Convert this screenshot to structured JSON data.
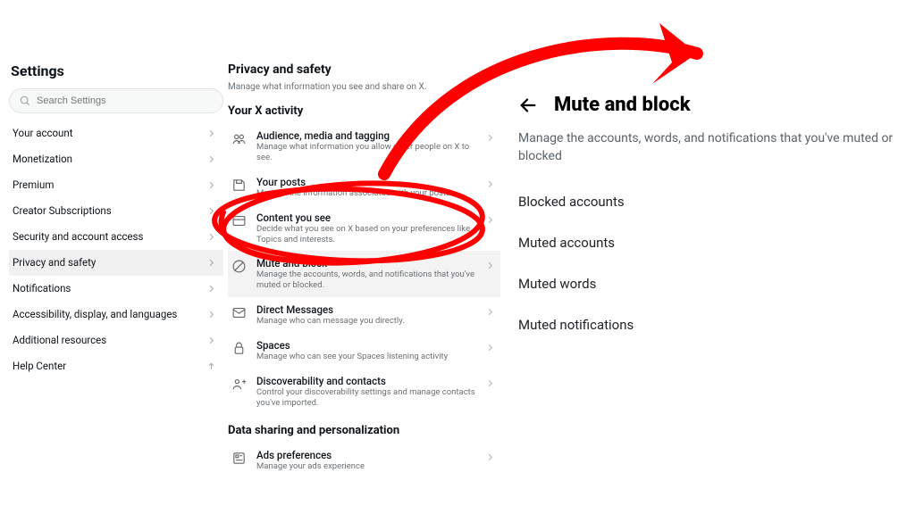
{
  "left": {
    "title": "Settings",
    "search_placeholder": "Search Settings",
    "items": [
      {
        "label": "Your account"
      },
      {
        "label": "Monetization"
      },
      {
        "label": "Premium"
      },
      {
        "label": "Creator Subscriptions"
      },
      {
        "label": "Security and account access"
      },
      {
        "label": "Privacy and safety",
        "active": true
      },
      {
        "label": "Notifications"
      },
      {
        "label": "Accessibility, display, and languages"
      },
      {
        "label": "Additional resources"
      },
      {
        "label": "Help Center",
        "external": true
      }
    ]
  },
  "mid": {
    "title": "Privacy and safety",
    "subtitle": "Manage what information you see and share on X.",
    "section_a": "Your X activity",
    "rows_a": [
      {
        "title": "Audience, media and tagging",
        "desc": "Manage what information you allow other people on X to see."
      },
      {
        "title": "Your posts",
        "desc": "Manage the information associated with your posts."
      },
      {
        "title": "Content you see",
        "desc": "Decide what you see on X based on your preferences like Topics and interests."
      },
      {
        "title": "Mute and block",
        "desc": "Manage the accounts, words, and notifications that you've muted or blocked.",
        "highlight": true
      },
      {
        "title": "Direct Messages",
        "desc": "Manage who can message you directly."
      },
      {
        "title": "Spaces",
        "desc": "Manage who can see your Spaces listening activity"
      },
      {
        "title": "Discoverability and contacts",
        "desc": "Control your discoverability settings and manage contacts you've imported."
      }
    ],
    "section_b": "Data sharing and personalization",
    "rows_b": [
      {
        "title": "Ads preferences",
        "desc": "Manage your ads experience"
      }
    ]
  },
  "zoom": {
    "title": "Mute and block",
    "desc": "Manage the accounts, words, and notifications that you've muted or blocked",
    "items": [
      "Blocked accounts",
      "Muted accounts",
      "Muted words",
      "Muted notifications"
    ]
  }
}
